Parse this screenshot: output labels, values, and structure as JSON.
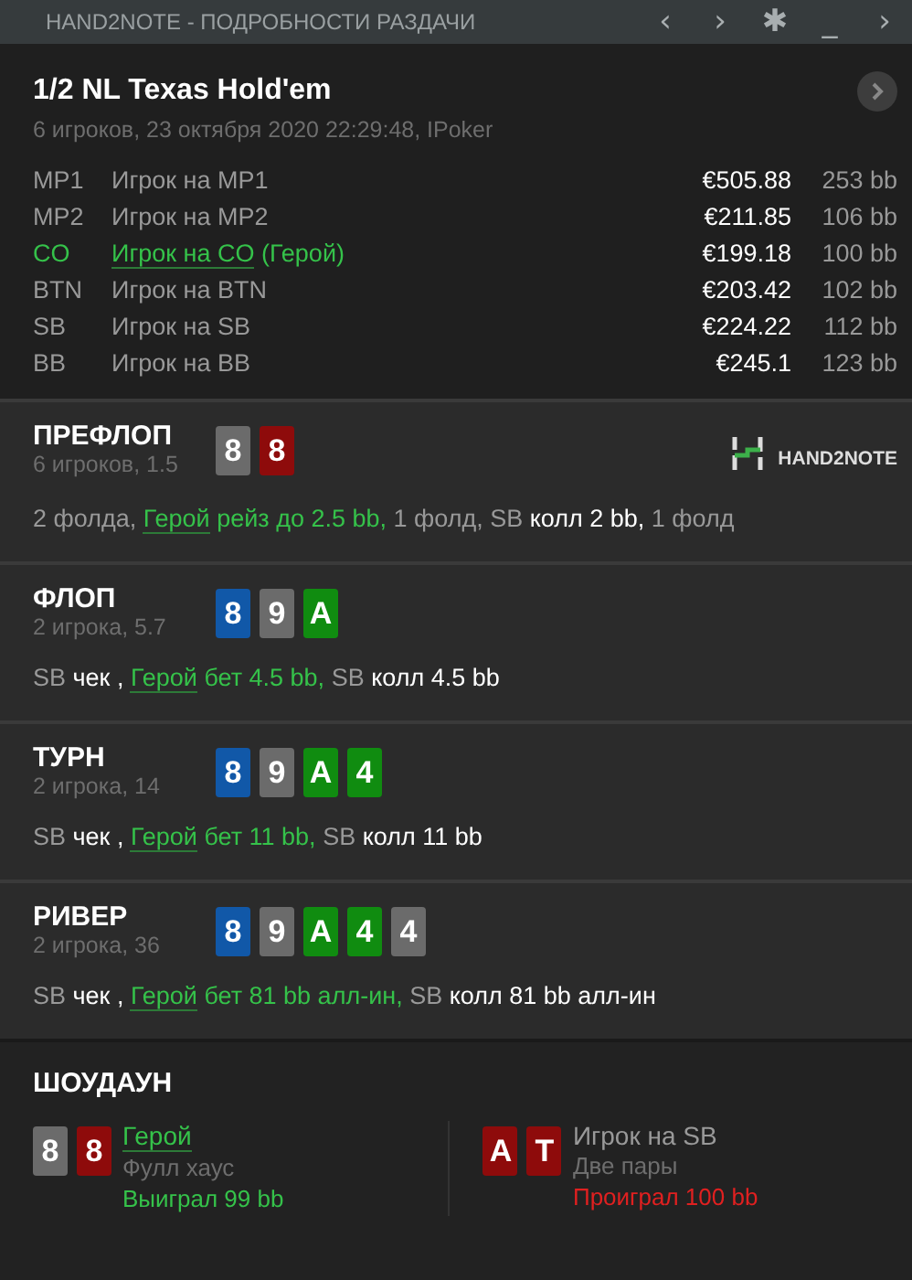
{
  "window": {
    "title": "HAND2NOTE - ПОДРОБНОСТИ РАЗДАЧИ",
    "controls": [
      "‹",
      "›",
      "✱",
      "_",
      "›"
    ]
  },
  "hand": {
    "title": "1/2 NL Texas Hold'em",
    "subtitle": "6 игроков, 23 октября 2020 22:29:48, IPoker"
  },
  "players": [
    {
      "position": "MP1",
      "name": "Игрок на MP1",
      "hero": false,
      "stack": "€505.88",
      "bb": "253 bb"
    },
    {
      "position": "MP2",
      "name": "Игрок на MP2",
      "hero": false,
      "stack": "€211.85",
      "bb": "106 bb"
    },
    {
      "position": "CO",
      "name": "Игрок на CO",
      "hero": true,
      "hero_tag": "(Герой)",
      "stack": "€199.18",
      "bb": "100 bb"
    },
    {
      "position": "BTN",
      "name": "Игрок на BTN",
      "hero": false,
      "stack": "€203.42",
      "bb": "102 bb"
    },
    {
      "position": "SB",
      "name": "Игрок на SB",
      "hero": false,
      "stack": "€224.22",
      "bb": "112 bb"
    },
    {
      "position": "BB",
      "name": "Игрок на BB",
      "hero": false,
      "stack": "€245.1",
      "bb": "123 bb"
    }
  ],
  "logo": {
    "text": "HAND2NOTE"
  },
  "streets": [
    {
      "name": "ПРЕФЛОП",
      "info": "6 игроков, 1.5",
      "logo": true,
      "cards": [
        {
          "rank": "8",
          "color": "#6b6b6b"
        },
        {
          "rank": "8",
          "color": "#8e0b0b"
        }
      ],
      "actions": [
        {
          "kind": "plain",
          "text": "2 фолда, "
        },
        {
          "kind": "hero_link",
          "text": "Герой"
        },
        {
          "kind": "hero",
          "text": " рейз до 2.5 bb,"
        },
        {
          "kind": "plain",
          "text": " 1 фолд, SB "
        },
        {
          "kind": "action",
          "text": "колл 2 bb,"
        },
        {
          "kind": "plain",
          "text": " 1 фолд"
        }
      ]
    },
    {
      "name": "ФЛОП",
      "info": "2 игрока, 5.7",
      "logo": false,
      "cards": [
        {
          "rank": "8",
          "color": "#1158a8"
        },
        {
          "rank": "9",
          "color": "#6b6b6b"
        },
        {
          "rank": "A",
          "color": "#108c10"
        }
      ],
      "actions": [
        {
          "kind": "plain",
          "text": "SB "
        },
        {
          "kind": "action",
          "text": "чек , "
        },
        {
          "kind": "hero_link",
          "text": "Герой"
        },
        {
          "kind": "hero",
          "text": " бет 4.5 bb,"
        },
        {
          "kind": "plain",
          "text": " SB "
        },
        {
          "kind": "action",
          "text": "колл 4.5 bb"
        }
      ]
    },
    {
      "name": "ТУРН",
      "info": "2 игрока, 14",
      "logo": false,
      "cards": [
        {
          "rank": "8",
          "color": "#1158a8"
        },
        {
          "rank": "9",
          "color": "#6b6b6b"
        },
        {
          "rank": "A",
          "color": "#108c10"
        },
        {
          "rank": "4",
          "color": "#108c10"
        }
      ],
      "actions": [
        {
          "kind": "plain",
          "text": "SB "
        },
        {
          "kind": "action",
          "text": "чек , "
        },
        {
          "kind": "hero_link",
          "text": "Герой"
        },
        {
          "kind": "hero",
          "text": " бет 11 bb,"
        },
        {
          "kind": "plain",
          "text": " SB "
        },
        {
          "kind": "action",
          "text": "колл 11 bb"
        }
      ]
    },
    {
      "name": "РИВЕР",
      "info": "2 игрока, 36",
      "logo": false,
      "cards": [
        {
          "rank": "8",
          "color": "#1158a8"
        },
        {
          "rank": "9",
          "color": "#6b6b6b"
        },
        {
          "rank": "A",
          "color": "#108c10"
        },
        {
          "rank": "4",
          "color": "#108c10"
        },
        {
          "rank": "4",
          "color": "#6b6b6b"
        }
      ],
      "actions": [
        {
          "kind": "plain",
          "text": "SB "
        },
        {
          "kind": "action",
          "text": "чек , "
        },
        {
          "kind": "hero_link",
          "text": "Герой"
        },
        {
          "kind": "hero",
          "text": " бет 81 bb алл-ин,"
        },
        {
          "kind": "plain",
          "text": " SB "
        },
        {
          "kind": "action",
          "text": "колл 81 bb алл-ин"
        }
      ]
    }
  ],
  "showdown": {
    "title": "ШОУДАУН",
    "hands": [
      {
        "player": "Герой",
        "hero": true,
        "won": true,
        "cards": [
          {
            "rank": "8",
            "color": "#6b6b6b"
          },
          {
            "rank": "8",
            "color": "#8e0b0b"
          }
        ],
        "combo": "Фулл хаус",
        "result": "Выиграл 99 bb"
      },
      {
        "player": "Игрок на SB",
        "hero": false,
        "won": false,
        "cards": [
          {
            "rank": "A",
            "color": "#8e0b0b"
          },
          {
            "rank": "T",
            "color": "#8e0b0b"
          }
        ],
        "combo": "Две пары",
        "result": "Проиграл 100 bb"
      }
    ]
  }
}
